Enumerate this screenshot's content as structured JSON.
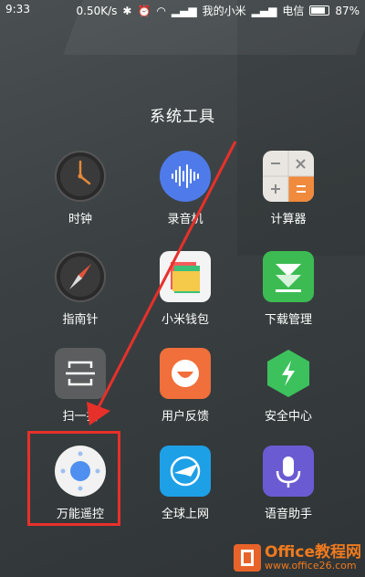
{
  "status_bar": {
    "time": "9:33",
    "speed": "0.50K/s",
    "carrier1": "我的小米",
    "carrier2": "电信",
    "battery": "87%"
  },
  "folder": {
    "title": "系统工具",
    "apps": [
      {
        "label": "时钟",
        "icon": "clock-icon"
      },
      {
        "label": "录音机",
        "icon": "sound-recorder-icon"
      },
      {
        "label": "计算器",
        "icon": "calculator-icon"
      },
      {
        "label": "指南针",
        "icon": "compass-icon"
      },
      {
        "label": "小米钱包",
        "icon": "wallet-icon"
      },
      {
        "label": "下载管理",
        "icon": "download-icon"
      },
      {
        "label": "扫一扫",
        "icon": "scanner-icon"
      },
      {
        "label": "用户反馈",
        "icon": "feedback-icon"
      },
      {
        "label": "安全中心",
        "icon": "security-icon"
      },
      {
        "label": "万能遥控",
        "icon": "remote-control-icon"
      },
      {
        "label": "全球上网",
        "icon": "global-internet-icon"
      },
      {
        "label": "语音助手",
        "icon": "voice-assistant-icon"
      }
    ]
  },
  "watermark": {
    "line1": "Office教程网",
    "line2": "www.office26.com"
  },
  "colors": {
    "highlight": "#e8302a",
    "arrow": "#e8302a"
  }
}
